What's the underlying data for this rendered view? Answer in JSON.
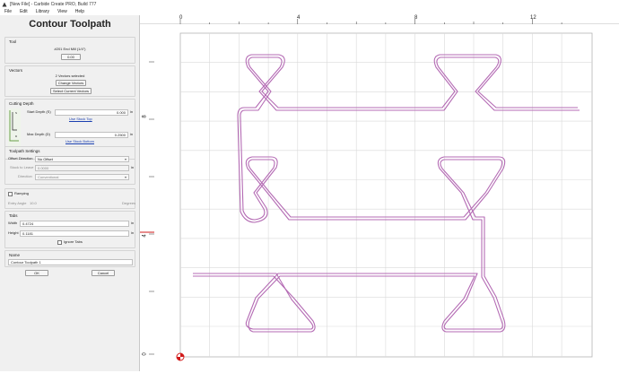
{
  "window": {
    "title": "[New File] - Carbide Create PRO, Build 777"
  },
  "menu": [
    "File",
    "Edit",
    "Library",
    "View",
    "Help"
  ],
  "panel": {
    "title": "Contour Toolpath",
    "tool": {
      "label": "Tool",
      "name": "#201 End Mill (1/4\")",
      "number": "0.00"
    },
    "vectors": {
      "label": "Vectors",
      "selected": "2 Vectors selected",
      "change_btn": "Change Vectors",
      "select_btn": "Select Current Vectors"
    },
    "cutting_depth": {
      "label": "Cutting Depth",
      "start_label": "Start Depth (S)",
      "start_value": "0.000",
      "start_unit": "in",
      "use_stock_top": "Use Stock Top",
      "max_label": "Max Depth (D)",
      "max_value": "0.2500",
      "max_unit": "in",
      "use_stock_bottom": "Use Stock Bottom"
    },
    "toolpath_settings": {
      "label": "Toolpath Settings",
      "offset_label": "Offset Direction",
      "offset_value": "No Offset",
      "stock_label": "Stock to Leave",
      "stock_value": "0.0000",
      "stock_unit": "in",
      "direction_label": "Direction",
      "direction_value": "Conventional"
    },
    "ramping": {
      "label": "Ramping",
      "entry_label": "Entry Angle",
      "entry_value": "10.0",
      "entry_unit": "Degrees"
    },
    "tabs": {
      "label": "Tabs",
      "width_label": "Width",
      "width_value": "0.4724",
      "width_unit": "in",
      "height_label": "Height",
      "height_value": "0.1181",
      "height_unit": "in",
      "ignore_label": "Ignore Tabs"
    },
    "name": {
      "label": "Name",
      "value": "Contour Toolpath 1"
    },
    "ok": "OK",
    "cancel": "Cancel"
  },
  "ruler": {
    "top_labels": [
      "0",
      "4",
      "8",
      "12"
    ],
    "left_labels": [
      "8",
      "4",
      "0"
    ]
  },
  "colors": {
    "toolpath": "#b46bb4",
    "grid": "#d9d9d9",
    "origin": "#d11a1a"
  }
}
